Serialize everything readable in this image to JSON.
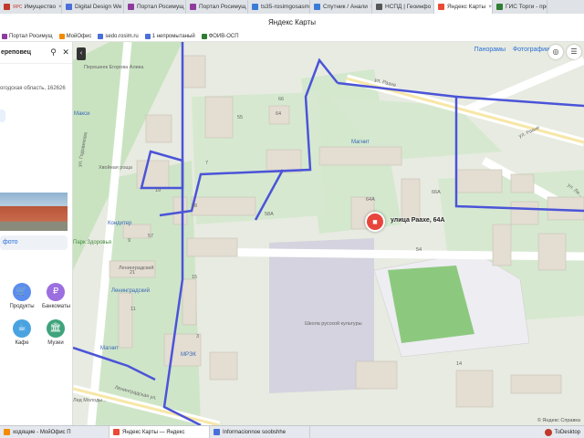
{
  "browser_tabs": [
    {
      "label": "Имущество",
      "prefix": "ЯРС",
      "active": false
    },
    {
      "label": "Digital Design We",
      "active": false
    },
    {
      "label": "Портал Росимущ",
      "active": false
    },
    {
      "label": "Портал Росимущ",
      "active": false
    },
    {
      "label": "ts35-rosimgosasm",
      "active": false
    },
    {
      "label": "Спутник / Анали",
      "active": false
    },
    {
      "label": "НСПД | Геоинфо",
      "active": false
    },
    {
      "label": "Яндекс Карты",
      "active": true
    },
    {
      "label": "ГИС Торги - прод",
      "active": false
    }
  ],
  "window_title": "Яндекс Карты",
  "bookmarks": [
    {
      "label": "Портал Росимущ"
    },
    {
      "label": "МойОфис"
    },
    {
      "label": "sedo.rosim.ru"
    },
    {
      "label": "1 непромытаный"
    },
    {
      "label": "ФОИВ-ОСП"
    }
  ],
  "panel": {
    "search_query": "ереповец",
    "address": "огодская область, 162626",
    "photo_link": "фото",
    "categories": [
      {
        "label": "Продукты",
        "icon": "cart-icon",
        "color": "#5b8def"
      },
      {
        "label": "Банкоматы",
        "icon": "ruble-icon",
        "color": "#9b6fe0"
      },
      {
        "label": "Кафе",
        "icon": "cup-icon",
        "color": "#4aa3e0"
      },
      {
        "label": "Музеи",
        "icon": "museum-icon",
        "color": "#3fa37c"
      }
    ]
  },
  "map": {
    "buttons": {
      "panoramas": "Панорамы",
      "photos": "Фотографии"
    },
    "pin_label": "улица Раахе, 64А",
    "streets": [
      {
        "text": "ул. Раахе"
      },
      {
        "text": "ул. Раахе"
      },
      {
        "text": "ул. Годовикова"
      },
      {
        "text": "Ленинградская ул."
      },
      {
        "text": "ул. Ле..."
      }
    ],
    "pois": [
      {
        "text": "Магнит",
        "kind": "blue"
      },
      {
        "text": "Ленинградский",
        "kind": "blue"
      },
      {
        "text": "Ленинградский",
        "kind": "gray"
      },
      {
        "text": "Магнит",
        "kind": "blue"
      },
      {
        "text": "МРЭК",
        "kind": "blue"
      },
      {
        "text": "Парк Здоровья",
        "kind": "green"
      },
      {
        "text": "Хвойная роща",
        "kind": "gray"
      },
      {
        "text": "Кондитер",
        "kind": "blue"
      },
      {
        "text": "Школа русской культуры",
        "kind": "gray"
      },
      {
        "text": "Перешеек Егорова Алика",
        "kind": "gray"
      },
      {
        "text": "Макси",
        "kind": "blue"
      },
      {
        "text": "Лед Молоды...",
        "kind": "gray"
      }
    ],
    "house_numbers": [
      "7",
      "64",
      "66A",
      "55",
      "66",
      "58A",
      "58",
      "64A",
      "57",
      "15",
      "11",
      "19",
      "9",
      "3",
      "14",
      "21",
      "54"
    ],
    "copyright": "© Яндекс  Справка"
  },
  "taskbar": [
    {
      "label": "ходящие - МойОфис П",
      "active": false
    },
    {
      "label": "Яндекс Карты — Яндекс",
      "active": true
    },
    {
      "label": "Informacionnoe soobshhe",
      "active": false
    }
  ],
  "tray_label": "ToDesktop"
}
